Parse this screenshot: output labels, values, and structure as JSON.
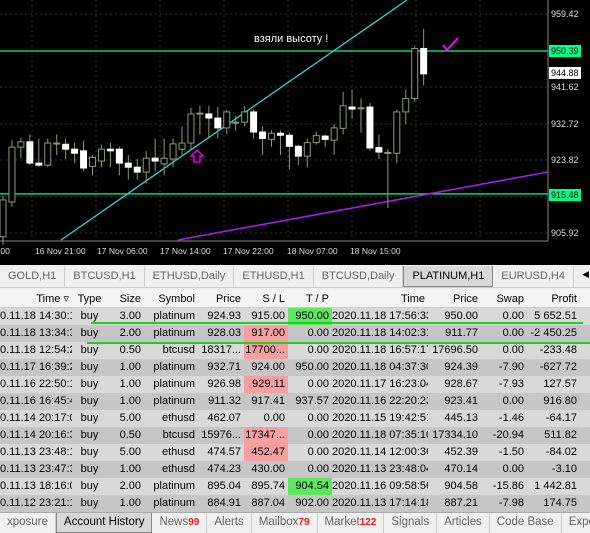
{
  "chart": {
    "symbol_period": "PLATINUM,H1",
    "annotation": "взяли высоту !",
    "background": "#000000",
    "horizontal_levels": [
      {
        "price": "950.39",
        "color": "#00ff88"
      },
      {
        "price": "915.48",
        "color": "#00ff88"
      }
    ],
    "current_price": "944.88",
    "price_axis": [
      "959.42",
      "941.62",
      "932.72",
      "923.82",
      "905.92"
    ],
    "time_axis": [
      ":00",
      "16 Nov 21:00",
      "17 Nov 06:00",
      "17 Nov 14:00",
      "17 Nov 22:00",
      "18 Nov 07:00",
      "18 Nov 15:00"
    ],
    "trendline_colors": {
      "uptrend": "#40d0d0",
      "support": "#a020e0"
    },
    "marker_colors": {
      "arrow": "#ff00ff",
      "check": "#ff00ff"
    },
    "candles_ohlc": [
      [
        905,
        915,
        903,
        914
      ],
      [
        913.5,
        928.6,
        912.3,
        926.9
      ],
      [
        926.9,
        929.1,
        924.2,
        928.2
      ],
      [
        928.2,
        930,
        922.5,
        923
      ],
      [
        923,
        929,
        922,
        922.5
      ],
      [
        922.5,
        929,
        922,
        927.9
      ],
      [
        927.7,
        930,
        925,
        927.9
      ],
      [
        927.6,
        929,
        924,
        926.4
      ],
      [
        926.4,
        928,
        923,
        925.4
      ],
      [
        926,
        928.5,
        921,
        921.8
      ],
      [
        922.2,
        925,
        920,
        924.4
      ],
      [
        923.5,
        927.5,
        922,
        926.4
      ],
      [
        926.4,
        928,
        922,
        926
      ],
      [
        926.4,
        927,
        920,
        923
      ],
      [
        923,
        925,
        919,
        922
      ],
      [
        922,
        924,
        919,
        920.8
      ],
      [
        920.8,
        926,
        918,
        924.2
      ],
      [
        924.2,
        929,
        921,
        923.5
      ],
      [
        922.8,
        929,
        920,
        924.2
      ],
      [
        924,
        929,
        922,
        927.7
      ],
      [
        926.4,
        932,
        925,
        927.9
      ],
      [
        927.9,
        936.5,
        926.4,
        935
      ],
      [
        935,
        937,
        930,
        935.2
      ],
      [
        935,
        937,
        929,
        934
      ],
      [
        934,
        936.7,
        929,
        931.6
      ],
      [
        931.6,
        936,
        930,
        935.5
      ],
      [
        933,
        934.5,
        931,
        933
      ],
      [
        933,
        937,
        932,
        935.5
      ],
      [
        935.5,
        936,
        929,
        930.6
      ],
      [
        930.6,
        932,
        925,
        929
      ],
      [
        928.8,
        931,
        927,
        930.3
      ],
      [
        930.3,
        931,
        925,
        929.8
      ],
      [
        929.8,
        930.5,
        921.5,
        927.1
      ],
      [
        927.1,
        927.5,
        922.5,
        924.7
      ],
      [
        924.7,
        929,
        922,
        928
      ],
      [
        928,
        930.7,
        927.5,
        929.7
      ],
      [
        929.6,
        930,
        927,
        928.8
      ],
      [
        928.6,
        932.5,
        925,
        931.6
      ],
      [
        931.5,
        940.4,
        930,
        937
      ],
      [
        936.7,
        941,
        933.8,
        936.2
      ],
      [
        936.5,
        938.8,
        930.4,
        936.5
      ],
      [
        936.7,
        937.7,
        926,
        926.7
      ],
      [
        926.8,
        930,
        924,
        925.7
      ],
      [
        925.6,
        926.4,
        912,
        925.6
      ],
      [
        925.4,
        936,
        923,
        935.5
      ],
      [
        935.5,
        941,
        932.5,
        938.8
      ],
      [
        938.8,
        951.5,
        938,
        951
      ],
      [
        951,
        955.8,
        942,
        944.8
      ]
    ]
  },
  "chart_tabs": [
    "GOLD,H1",
    "BTCUSD,H1",
    "ETHUSD,Daily",
    "ETHUSD,H1",
    "BTCUSD,Daily",
    "PLATINUM,H1",
    "EURUSD,H4"
  ],
  "active_chart_tab": "PLATINUM,H1",
  "history": {
    "columns": [
      "Time",
      "Type",
      "Size",
      "Symbol",
      "Price",
      "S / L",
      "T / P",
      "Time",
      "Price",
      "Swap",
      "Profit"
    ],
    "highlight_colors": {
      "sl": "#f4a0a0",
      "tp": "#5fe85f",
      "underline": "#22cc22"
    },
    "rows": [
      {
        "cells": [
          "0.11.18 14:30:10",
          "buy",
          "3.00",
          "platinum",
          "924.93",
          "915.00",
          "950.00",
          "2020.11.18 17:56:33",
          "950.00",
          "0.00",
          "5 652.51"
        ],
        "tp_hl": true
      },
      {
        "cells": [
          "0.11.18 13:34:38",
          "buy",
          "2.00",
          "platinum",
          "928.03",
          "917.00",
          "0.00",
          "2020.11.18 14:02:31",
          "911.77",
          "0.00",
          "-2 450.25"
        ],
        "sl_hl": true
      },
      {
        "cells": [
          "0.11.18 12:54:25",
          "buy",
          "0.50",
          "btcusd",
          "18317...",
          "17700...",
          "0.00",
          "2020.11.18 16:57:17",
          "17696.50",
          "0.00",
          "-233.48"
        ],
        "sl_hl": true
      },
      {
        "cells": [
          "0.11.17 16:39:29",
          "buy",
          "1.00",
          "platinum",
          "932.71",
          "924.00",
          "950.00",
          "2020.11.18 04:37:30",
          "924.39",
          "-7.90",
          "-627.72"
        ]
      },
      {
        "cells": [
          "0.11.16 22:50:16",
          "buy",
          "1.00",
          "platinum",
          "926.98",
          "929.11",
          "0.00",
          "2020.11.17 16:23:04",
          "928.67",
          "-7.93",
          "127.57"
        ],
        "sl_hl": true
      },
      {
        "cells": [
          "0.11.16 16:45:41",
          "buy",
          "1.00",
          "platinum",
          "911.32",
          "917.41",
          "937.57",
          "2020.11.16 22:20:23",
          "923.41",
          "0.00",
          "916.80"
        ]
      },
      {
        "cells": [
          "0.11.14 20:17:02",
          "buy",
          "5.00",
          "ethusd",
          "462.07",
          "0.00",
          "0.00",
          "2020.11.15 19:42:51",
          "445.13",
          "-1.46",
          "-64.17"
        ]
      },
      {
        "cells": [
          "0.11.14 20:16:38",
          "buy",
          "0.50",
          "btcusd",
          "15976...",
          "17347...",
          "0.00",
          "2020.11.18 07:35:10",
          "17334.10",
          "-20.94",
          "511.82"
        ],
        "sl_hl": true
      },
      {
        "cells": [
          "0.11.13 23:48:18",
          "buy",
          "5.00",
          "ethusd",
          "474.57",
          "452.47",
          "0.00",
          "2020.11.14 12:00:36",
          "452.39",
          "-1.50",
          "-84.02"
        ],
        "sl_hl": true
      },
      {
        "cells": [
          "0.11.13 23:47:32",
          "buy",
          "1.00",
          "ethusd",
          "474.23",
          "430.00",
          "0.00",
          "2020.11.13 23:48:04",
          "470.14",
          "0.00",
          "-3.10"
        ]
      },
      {
        "cells": [
          "0.11.13 18:16:04",
          "buy",
          "2.00",
          "platinum",
          "895.04",
          "895.74",
          "904.54",
          "2020.11.16 09:58:56",
          "904.58",
          "-15.86",
          "1 442.81"
        ],
        "tp_hl": true
      },
      {
        "cells": [
          "0.11.12 23:21:19",
          "buy",
          "1.00",
          "platinum",
          "884.91",
          "887.04",
          "902.00",
          "2020.11.13 17:14:18",
          "887.21",
          "-7.98",
          "174.75"
        ]
      }
    ]
  },
  "bottom_tabs": [
    {
      "label": "xposure"
    },
    {
      "label": "Account History",
      "active": true
    },
    {
      "label": "News",
      "count": "99"
    },
    {
      "label": "Alerts"
    },
    {
      "label": "Mailbox",
      "count": "79"
    },
    {
      "label": "Market",
      "count": "122"
    },
    {
      "label": "Signals"
    },
    {
      "label": "Articles"
    },
    {
      "label": "Code Base"
    },
    {
      "label": "Exper"
    }
  ]
}
